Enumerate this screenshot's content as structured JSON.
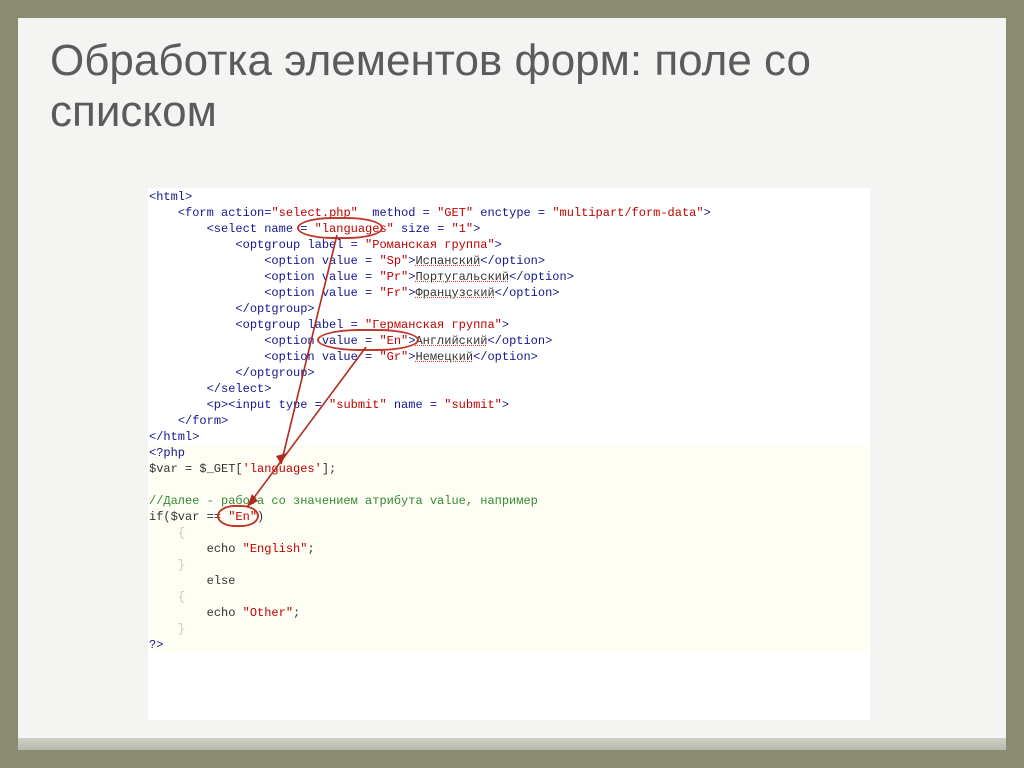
{
  "title": "Обработка элементов форм: поле со списком",
  "code": {
    "l01_a": "<html>",
    "l02_a": "    ",
    "l02_b": "<form ",
    "l02_c": "action=",
    "l02_d": "\"select.php\"",
    "l02_e": "  method = ",
    "l02_f": "\"GET\"",
    "l02_g": " enctype = ",
    "l02_h": "\"multipart/form-data\"",
    "l02_i": ">",
    "l03_a": "        ",
    "l03_b": "<select ",
    "l03_c": "name = ",
    "l03_d": "\"languages\"",
    "l03_e": " size = ",
    "l03_f": "\"1\"",
    "l03_g": ">",
    "l04_a": "            ",
    "l04_b": "<optgroup ",
    "l04_c": "label = ",
    "l04_d": "\"Романская группа\"",
    "l04_e": ">",
    "l05_a": "                ",
    "l05_b": "<option ",
    "l05_c": "value = ",
    "l05_d": "\"Sp\"",
    "l05_e": ">",
    "l05_f": "Испанский",
    "l05_g": "</option>",
    "l06_a": "                ",
    "l06_b": "<option ",
    "l06_c": "value = ",
    "l06_d": "\"Pr\"",
    "l06_e": ">",
    "l06_f": "Португальский",
    "l06_g": "</option>",
    "l07_a": "                ",
    "l07_b": "<option ",
    "l07_c": "value = ",
    "l07_d": "\"Fr\"",
    "l07_e": ">",
    "l07_f": "Французский",
    "l07_g": "</option>",
    "l08_a": "            ",
    "l08_b": "</optgroup>",
    "l09_a": "            ",
    "l09_b": "<optgroup ",
    "l09_c": "label = ",
    "l09_d": "\"Германская группа\"",
    "l09_e": ">",
    "l10_a": "                ",
    "l10_b": "<option ",
    "l10_c": "value = ",
    "l10_d": "\"En\"",
    "l10_e": ">",
    "l10_f": "Английский",
    "l10_g": "</option>",
    "l11_a": "                ",
    "l11_b": "<option ",
    "l11_c": "value = ",
    "l11_d": "\"Gr\"",
    "l11_e": ">",
    "l11_f": "Немецкий",
    "l11_g": "</option>",
    "l12_a": "            ",
    "l12_b": "</optgroup>",
    "l13_a": "        ",
    "l13_b": "</select>",
    "l14_a": "        ",
    "l14_b": "<p><input ",
    "l14_c": "type = ",
    "l14_d": "\"submit\"",
    "l14_e": " name = ",
    "l14_f": "\"submit\"",
    "l14_g": ">",
    "l15_a": "    ",
    "l15_b": "</form>",
    "l16_a": "</html>",
    "l17": "<?php",
    "l18_a": "$var = $_GET[",
    "l18_b": "'languages'",
    "l18_c": "];",
    "comment": "//Далее - работа со значением атрибута value, например",
    "l20_a": "if($var == ",
    "l20_b": "\"En\"",
    "l20_c": ")",
    "l21": "    {",
    "l22_a": "    echo ",
    "l22_b": "\"English\"",
    "l22_c": ";",
    "l23": "    }",
    "l24": "    else",
    "l25": "    {",
    "l26_a": "    echo ",
    "l26_b": "\"Other\"",
    "l26_c": ";",
    "l27": "    }",
    "l28": "?>"
  }
}
